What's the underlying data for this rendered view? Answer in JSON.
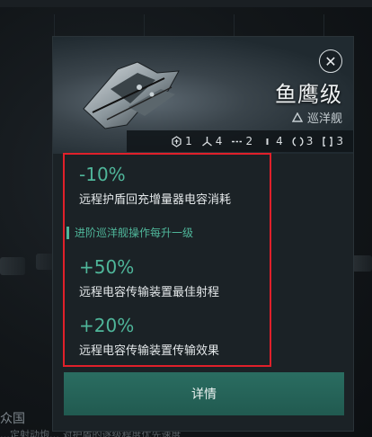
{
  "background": {
    "caption": "众国",
    "subcaption": "…定射动炮… 对护盾的逐级程度优先速度"
  },
  "card": {
    "ship_name": "鱼鹰级",
    "ship_class": "巡洋舰",
    "close_icon": "close-icon",
    "slots": [
      {
        "icon": "turret-hardpoint-icon",
        "count": "1"
      },
      {
        "icon": "launcher-hardpoint-icon",
        "count": "4"
      },
      {
        "icon": "high-slot-icon",
        "count": "2"
      },
      {
        "icon": "mid-slot-icon",
        "count": "4"
      },
      {
        "icon": "low-slot-icon",
        "count": "3"
      },
      {
        "icon": "rig-slot-icon",
        "count": "3"
      }
    ],
    "bonuses_top": [
      {
        "value": "-10%",
        "description": "远程护盾回充增量器电容消耗"
      }
    ],
    "section_label": "进阶巡洋舰操作每升一级",
    "bonuses_section": [
      {
        "value": "+50%",
        "description": "远程电容传输装置最佳射程"
      },
      {
        "value": "+20%",
        "description": "远程电容传输装置传输效果"
      }
    ],
    "details_label": "详情"
  },
  "colors": {
    "accent": "#4fb69a",
    "button": "#2a6d61",
    "highlight_border": "#e0202a"
  }
}
